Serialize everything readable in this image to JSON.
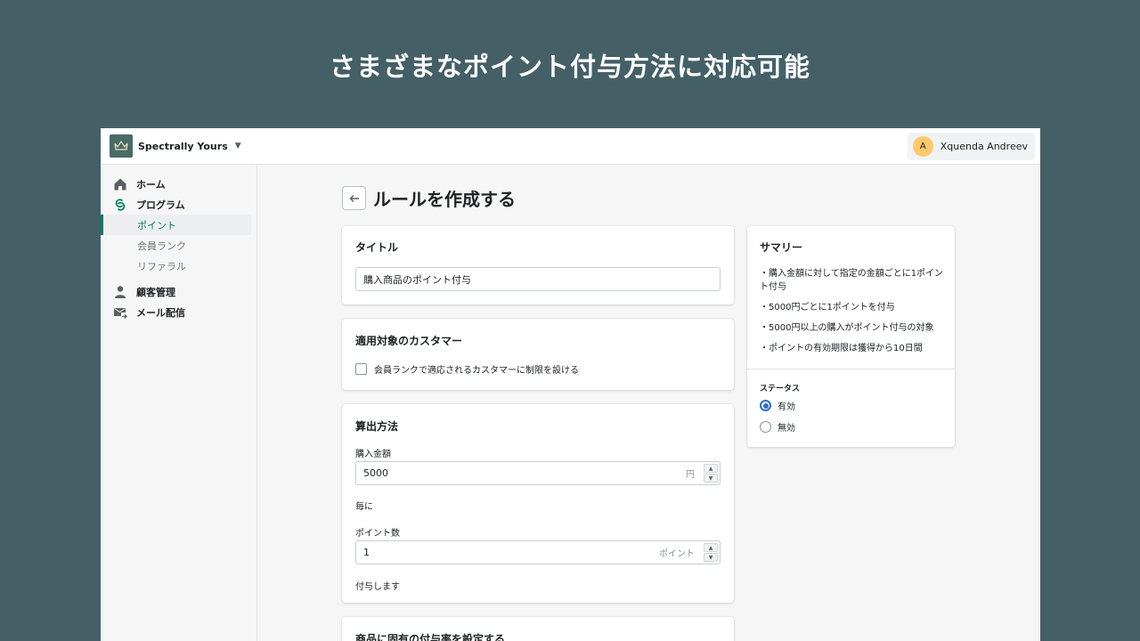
{
  "headline": "さまざまなポイント付与方法に対応可能",
  "topbar": {
    "store_name": "Spectrally Yours",
    "user_initial": "A",
    "user_name": "Xquenda Andreev"
  },
  "sidebar": {
    "home": "ホーム",
    "program": "プログラム",
    "sub_items": [
      "ポイント",
      "会員ランク",
      "リファラル"
    ],
    "customers": "顧客管理",
    "mail": "メール配信"
  },
  "page": {
    "title": "ルールを作成する"
  },
  "title_card": {
    "heading": "タイトル",
    "value": "購入商品のポイント付与"
  },
  "customer_card": {
    "heading": "適用対象のカスタマー",
    "checkbox_label": "会員ランクで適応されるカスタマーに制限を設ける",
    "checked": false
  },
  "calc_card": {
    "heading": "算出方法",
    "amount_label": "購入金額",
    "amount_value": "5000",
    "amount_suffix": "円",
    "per_text": "毎に",
    "points_label": "ポイント数",
    "points_value": "1",
    "points_suffix": "ポイント",
    "grant_text": "付与します"
  },
  "product_card": {
    "heading": "商品に固有の付与率を設定する"
  },
  "summary_card": {
    "heading": "サマリー",
    "lines": [
      "・購入金額に対して指定の金額ごとに1ポイント付与",
      "・5000円ごとに1ポイントを付与",
      "・5000円以上の購入がポイント付与の対象",
      "・ポイントの有効期限は獲得から10日間"
    ],
    "status_heading": "ステータス",
    "status_options": [
      "有効",
      "無効"
    ],
    "status_selected": "有効"
  },
  "colors": {
    "background": "#446066",
    "accent_green": "#008060",
    "radio_blue": "#2c6ecb",
    "avatar": "#ffc96b"
  }
}
